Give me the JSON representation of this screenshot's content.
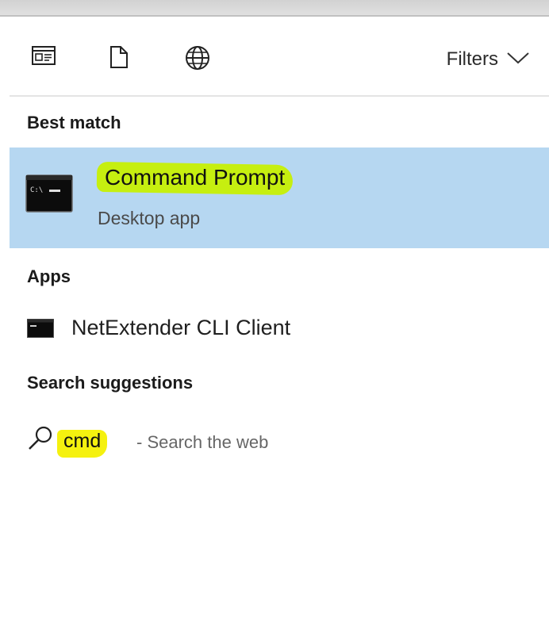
{
  "toolbar": {
    "filters_label": "Filters",
    "icons": [
      "apps-icon",
      "document-icon",
      "globe-icon"
    ]
  },
  "sections": {
    "best_match": "Best match",
    "apps": "Apps",
    "search_suggestions": "Search suggestions"
  },
  "best_match_item": {
    "title": "Command Prompt",
    "subtitle": "Desktop app"
  },
  "apps_items": [
    {
      "label": "NetExtender CLI Client"
    }
  ],
  "suggestion": {
    "query": "cmd",
    "suffix": "- Search the web"
  },
  "colors": {
    "selected_row": "#b6d7f1",
    "highlight_green": "#c6ef10",
    "highlight_yellow": "#f5f10f"
  }
}
